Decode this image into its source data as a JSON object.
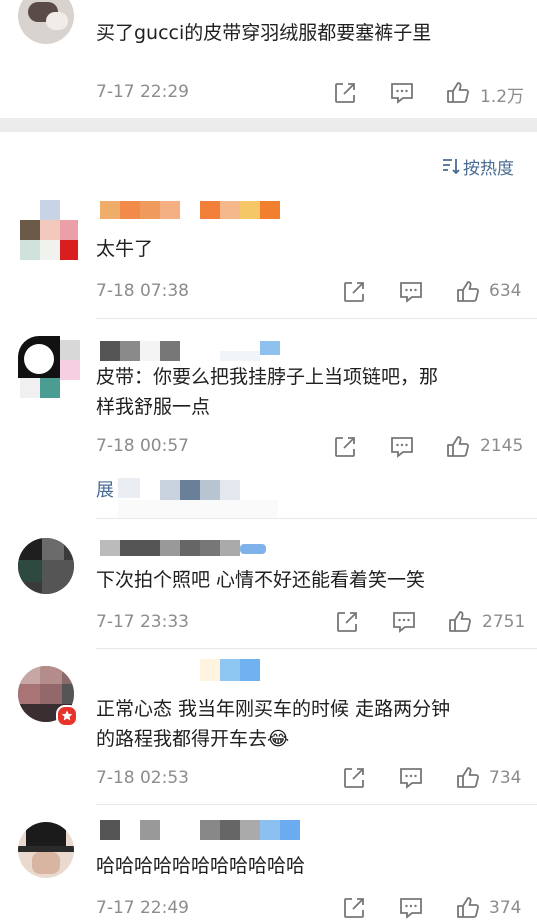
{
  "top_comment": {
    "text": "买了gucci的皮带穿羽绒服都要塞裤子里",
    "time": "7-17 22:29",
    "likes": "1.2万"
  },
  "sort": {
    "label": "按热度"
  },
  "comments": [
    {
      "text": "太牛了",
      "time": "7-18 07:38",
      "likes": "634"
    },
    {
      "text_line1": "皮带：你要么把我挂脖子上当项链吧，那",
      "text_line2": "样我舒服一点",
      "time": "7-18 00:57",
      "likes": "2145",
      "expand": "展"
    },
    {
      "text": "下次拍个照吧 心情不好还能看着笑一笑",
      "time": "7-17 23:33",
      "likes": "2751"
    },
    {
      "text_line1": "正常心态 我当年刚买车的时候 走路两分钟",
      "text_line2": "的路程我都得开车去😂",
      "time": "7-18 02:53",
      "likes": "734"
    },
    {
      "text": "哈哈哈哈哈哈哈哈哈哈哈",
      "time": "7-17 22:49",
      "likes": "374"
    }
  ],
  "icons": {
    "share": "share-icon",
    "comment": "comment-icon",
    "like": "thumbs-up-icon"
  }
}
